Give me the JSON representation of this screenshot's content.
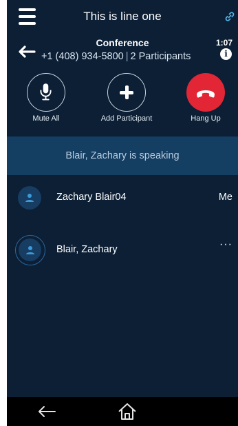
{
  "header": {
    "line_title": "This is line one",
    "menu_icon": "hamburger-menu-icon",
    "link_icon": "link-icon"
  },
  "call": {
    "title": "Conference",
    "phone": "+1 (408) 934-5800",
    "separator": "|",
    "participants_count": "2 Participants",
    "timer": "1:07",
    "info_glyph": "i"
  },
  "actions": {
    "mute_all": "Mute All",
    "add_participant": "Add Participant",
    "hang_up": "Hang Up"
  },
  "speaking_banner": "Blair, Zachary is speaking",
  "participants": [
    {
      "name": "Zachary Blair04",
      "tag": "Me"
    },
    {
      "name": "Blair, Zachary",
      "more": "···"
    }
  ],
  "colors": {
    "background": "#0c1f35",
    "banner": "#143e62",
    "hang_up": "#e32636",
    "avatar": "#173d63"
  }
}
